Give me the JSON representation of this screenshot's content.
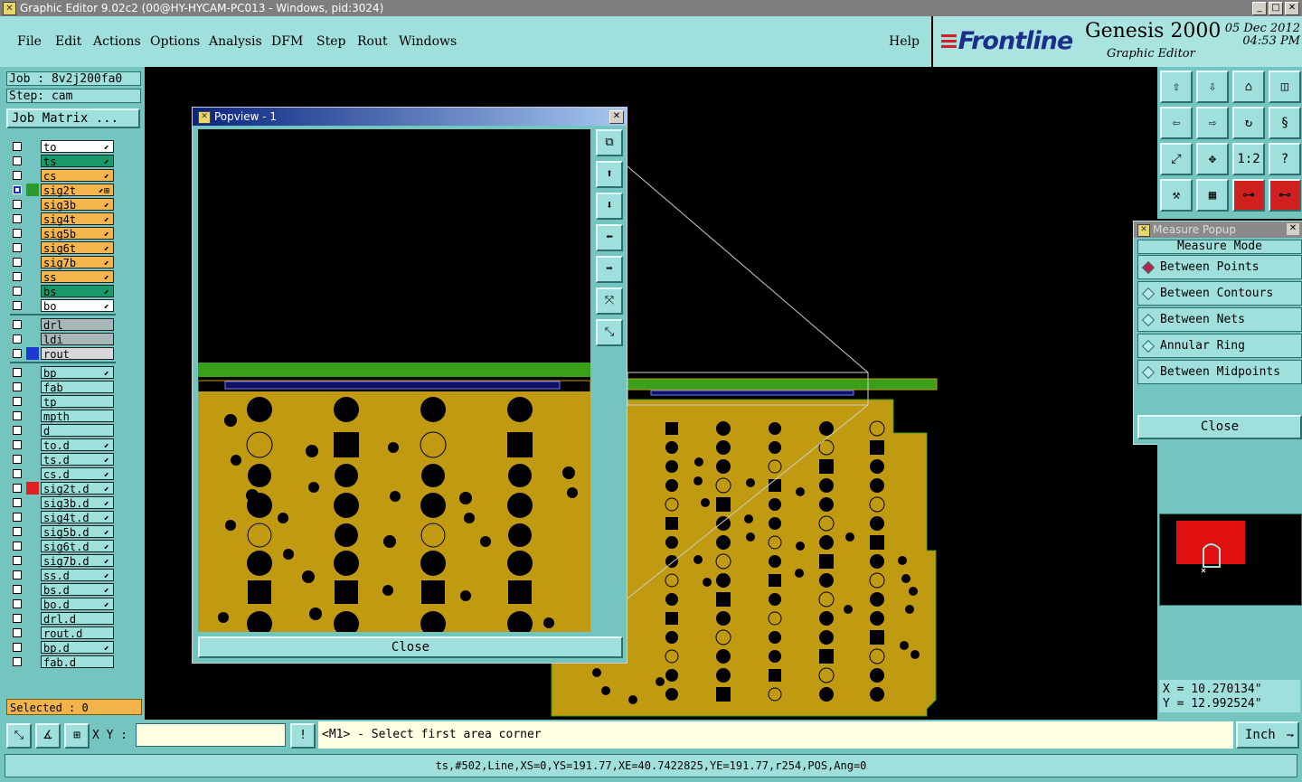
{
  "window": {
    "title": "Graphic Editor 9.02c2 (00@HY-HYCAM-PC013 - Windows, pid:3024)"
  },
  "menu": {
    "items": [
      "File",
      "Edit",
      "Actions",
      "Options",
      "Analysis",
      "DFM",
      "Step",
      "Rout",
      "Windows"
    ],
    "help": "Help"
  },
  "brand": {
    "logo": "Frontline",
    "product": "Genesis 2000",
    "subtitle": "Graphic Editor",
    "date": "05 Dec 2012",
    "time": "04:53 PM"
  },
  "left": {
    "job": "Job : 8v2j200fa0",
    "step": "Step: cam",
    "job_matrix": "Job Matrix ...",
    "selected": "Selected : 0"
  },
  "layers": [
    {
      "name": "to",
      "bg": "#ffffff",
      "mark": "",
      "arrow": "⬋"
    },
    {
      "name": "ts",
      "bg": "#1a9a6a",
      "mark": "",
      "arrow": "⬋"
    },
    {
      "name": "cs",
      "bg": "#f5b44c",
      "mark": "",
      "arrow": "⬋"
    },
    {
      "name": "sig2t",
      "bg": "#f5b44c",
      "mark": "#2a9a2a",
      "arrow": "⬋⊞",
      "checked": true
    },
    {
      "name": "sig3b",
      "bg": "#f5b44c",
      "mark": "",
      "arrow": "⬋"
    },
    {
      "name": "sig4t",
      "bg": "#f5b44c",
      "mark": "",
      "arrow": "⬋"
    },
    {
      "name": "sig5b",
      "bg": "#f5b44c",
      "mark": "",
      "arrow": "⬋"
    },
    {
      "name": "sig6t",
      "bg": "#f5b44c",
      "mark": "",
      "arrow": "⬋"
    },
    {
      "name": "sig7b",
      "bg": "#f5b44c",
      "mark": "",
      "arrow": "⬋"
    },
    {
      "name": "ss",
      "bg": "#f5b44c",
      "mark": "",
      "arrow": "⬋"
    },
    {
      "name": "bs",
      "bg": "#1a9a6a",
      "mark": "",
      "arrow": "⬋"
    },
    {
      "name": "bo",
      "bg": "#ffffff",
      "mark": "",
      "arrow": "⬋"
    },
    {
      "name": "drl",
      "bg": "#a8b8b8",
      "mark": "",
      "arrow": ""
    },
    {
      "name": "ldi",
      "bg": "#a8b8b8",
      "mark": "",
      "arrow": ""
    },
    {
      "name": "rout",
      "bg": "#d8d8d8",
      "mark": "#1a3ad0",
      "arrow": ""
    },
    {
      "name": "bp",
      "bg": "#9fe0dc",
      "mark": "",
      "arrow": "⬋"
    },
    {
      "name": "fab",
      "bg": "#9fe0dc",
      "mark": "",
      "arrow": ""
    },
    {
      "name": "tp",
      "bg": "#9fe0dc",
      "mark": "",
      "arrow": ""
    },
    {
      "name": "mpth",
      "bg": "#9fe0dc",
      "mark": "",
      "arrow": ""
    },
    {
      "name": "d",
      "bg": "#9fe0dc",
      "mark": "",
      "arrow": ""
    },
    {
      "name": "to.d",
      "bg": "#9fe0dc",
      "mark": "",
      "arrow": "⬋"
    },
    {
      "name": "ts.d",
      "bg": "#9fe0dc",
      "mark": "",
      "arrow": "⬋"
    },
    {
      "name": "cs.d",
      "bg": "#9fe0dc",
      "mark": "",
      "arrow": "⬋"
    },
    {
      "name": "sig2t.d",
      "bg": "#9fe0dc",
      "mark": "#e02020",
      "arrow": "⬋"
    },
    {
      "name": "sig3b.d",
      "bg": "#9fe0dc",
      "mark": "",
      "arrow": "⬋"
    },
    {
      "name": "sig4t.d",
      "bg": "#9fe0dc",
      "mark": "",
      "arrow": "⬋"
    },
    {
      "name": "sig5b.d",
      "bg": "#9fe0dc",
      "mark": "",
      "arrow": "⬋"
    },
    {
      "name": "sig6t.d",
      "bg": "#9fe0dc",
      "mark": "",
      "arrow": "⬋"
    },
    {
      "name": "sig7b.d",
      "bg": "#9fe0dc",
      "mark": "",
      "arrow": "⬋"
    },
    {
      "name": "ss.d",
      "bg": "#9fe0dc",
      "mark": "",
      "arrow": "⬋"
    },
    {
      "name": "bs.d",
      "bg": "#9fe0dc",
      "mark": "",
      "arrow": "⬋"
    },
    {
      "name": "bo.d",
      "bg": "#9fe0dc",
      "mark": "",
      "arrow": "⬋"
    },
    {
      "name": "drl.d",
      "bg": "#9fe0dc",
      "mark": "",
      "arrow": ""
    },
    {
      "name": "rout.d",
      "bg": "#9fe0dc",
      "mark": "",
      "arrow": ""
    },
    {
      "name": "bp.d",
      "bg": "#9fe0dc",
      "mark": "",
      "arrow": "⬋"
    },
    {
      "name": "fab.d",
      "bg": "#9fe0dc",
      "mark": "",
      "arrow": ""
    }
  ],
  "popview": {
    "title": "Popview - 1",
    "close": "Close"
  },
  "measure": {
    "title": "Measure Popup",
    "mode": "Measure Mode",
    "options": [
      "Between Points",
      "Between Contours",
      "Between Nets",
      "Annular Ring",
      "Between Midpoints"
    ],
    "selected": "Between Points",
    "close": "Close"
  },
  "coords": {
    "x": "X = 10.270134\"",
    "y": "Y = 12.992524\""
  },
  "bottom": {
    "xy_label": "X Y :",
    "xy_value": "",
    "prompt": "<M1> - Select first area corner",
    "unit": "Inch"
  },
  "status": "ts,#502,Line,XS=0,YS=191.77,XE=40.7422825,YE=191.77,r254,POS,Ang=0",
  "colors": {
    "board": "#c09a10",
    "trace": "#3aa01a",
    "panel": "#74c4c0",
    "panel_light": "#9fe0dc"
  }
}
